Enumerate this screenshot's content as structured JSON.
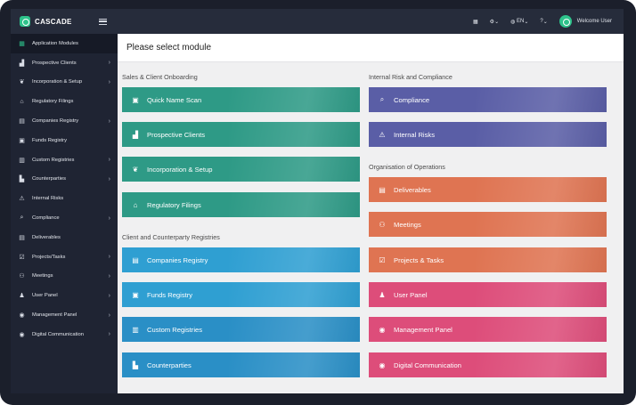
{
  "app": {
    "name": "CASCADE"
  },
  "topbar": {
    "lang": "EN",
    "help": "?",
    "user": "Welcome User"
  },
  "sidebar": {
    "items": [
      {
        "label": "Application Modules",
        "icon": "grid-icon",
        "chevron": false
      },
      {
        "label": "Prospective Clients",
        "icon": "bar-chart-icon",
        "chevron": true
      },
      {
        "label": "Incorporation & Setup",
        "icon": "leaf-icon",
        "chevron": true
      },
      {
        "label": "Regulatory Filings",
        "icon": "bank-icon",
        "chevron": false
      },
      {
        "label": "Companies Registry",
        "icon": "building-icon",
        "chevron": true
      },
      {
        "label": "Funds Registry",
        "icon": "wallet-icon",
        "chevron": false
      },
      {
        "label": "Custom Registries",
        "icon": "columns-icon",
        "chevron": true
      },
      {
        "label": "Counterparties",
        "icon": "buildings-icon",
        "chevron": true
      },
      {
        "label": "Internal Risks",
        "icon": "warning-icon",
        "chevron": false
      },
      {
        "label": "Compliance",
        "icon": "search-icon",
        "chevron": true
      },
      {
        "label": "Deliverables",
        "icon": "document-icon",
        "chevron": false
      },
      {
        "label": "Projects/Tasks",
        "icon": "checkbox-icon",
        "chevron": true
      },
      {
        "label": "Meetings",
        "icon": "people-icon",
        "chevron": true
      },
      {
        "label": "User Panel",
        "icon": "user-icon",
        "chevron": true
      },
      {
        "label": "Management Panel",
        "icon": "eye-icon",
        "chevron": true
      },
      {
        "label": "Digital Communication",
        "icon": "eye-icon",
        "chevron": true
      }
    ]
  },
  "main": {
    "title": "Please select module",
    "sections": {
      "sales": "Sales & Client Onboarding",
      "client": "Client and Counterparty Registries",
      "risk": "Internal Risk and Compliance",
      "ops": "Organisation of Operations"
    },
    "tiles": {
      "quick": "Quick Name Scan",
      "prospective": "Prospective Clients",
      "incorporation": "Incorporation & Setup",
      "regulatory": "Regulatory Filings",
      "companies": "Companies Registry",
      "funds": "Funds Registry",
      "custom": "Custom Registries",
      "counterparties": "Counterparties",
      "compliance": "Compliance",
      "risks": "Internal Risks",
      "deliverables": "Deliverables",
      "meetings": "Meetings",
      "projects": "Projects & Tasks",
      "user": "User Panel",
      "management": "Management Panel",
      "digital": "Digital Communication"
    }
  },
  "colors": {
    "teal": "#2e9a86",
    "blue": "#2f9fd2",
    "purple": "#5a5ea6",
    "orange": "#df7452",
    "pink": "#dd4d7a",
    "accent": "#2ec28b"
  }
}
